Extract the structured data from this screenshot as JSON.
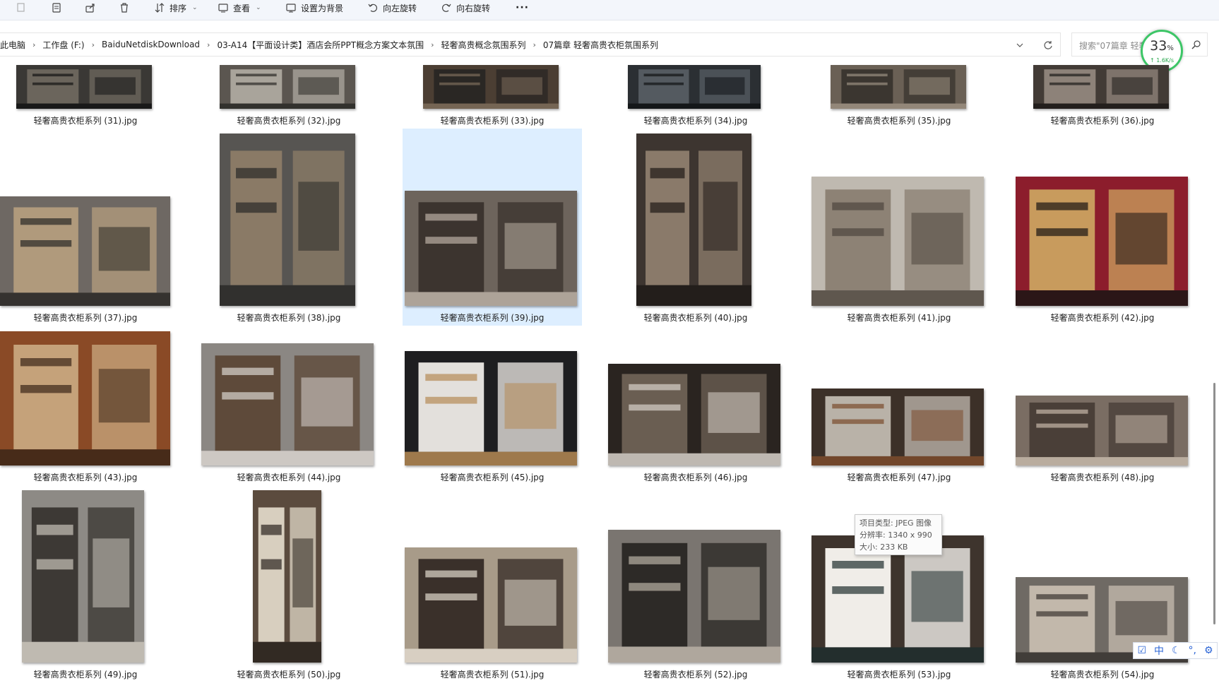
{
  "toolbar": {
    "sort_label": "排序",
    "view_label": "查看",
    "set_bg_label": "设置为背景",
    "rotate_left_label": "向左旋转",
    "rotate_right_label": "向右旋转",
    "more_label": "···"
  },
  "breadcrumb": [
    "此电脑",
    "工作盘 (F:)",
    "BaiduNetdiskDownload",
    "03-A14【平面设计类】酒店会所PPT概念方案文本氛围",
    "轻奢高贵概念氛围系列",
    "07篇章  轻奢高贵衣柜氛围系列"
  ],
  "breadcrumb_sep": "›",
  "search": {
    "placeholder": "搜索\"07篇章  轻奢..."
  },
  "net_widget": {
    "percent": "33",
    "unit": "%",
    "speed": "↑ 1.6K/s"
  },
  "files": [
    {
      "name": "轻奢高贵衣柜系列 (31).jpg"
    },
    {
      "name": "轻奢高贵衣柜系列 (32).jpg"
    },
    {
      "name": "轻奢高贵衣柜系列 (33).jpg"
    },
    {
      "name": "轻奢高贵衣柜系列 (34).jpg"
    },
    {
      "name": "轻奢高贵衣柜系列 (35).jpg"
    },
    {
      "name": "轻奢高贵衣柜系列 (36).jpg"
    },
    {
      "name": "轻奢高贵衣柜系列 (37).jpg"
    },
    {
      "name": "轻奢高贵衣柜系列 (38).jpg"
    },
    {
      "name": "轻奢高贵衣柜系列 (39).jpg",
      "selected": true
    },
    {
      "name": "轻奢高贵衣柜系列 (40).jpg"
    },
    {
      "name": "轻奢高贵衣柜系列 (41).jpg"
    },
    {
      "name": "轻奢高贵衣柜系列 (42).jpg"
    },
    {
      "name": "轻奢高贵衣柜系列 (43).jpg"
    },
    {
      "name": "轻奢高贵衣柜系列 (44).jpg"
    },
    {
      "name": "轻奢高贵衣柜系列 (45).jpg"
    },
    {
      "name": "轻奢高贵衣柜系列 (46).jpg"
    },
    {
      "name": "轻奢高贵衣柜系列 (47).jpg"
    },
    {
      "name": "轻奢高贵衣柜系列 (48).jpg"
    },
    {
      "name": "轻奢高贵衣柜系列 (49).jpg"
    },
    {
      "name": "轻奢高贵衣柜系列 (50).jpg"
    },
    {
      "name": "轻奢高贵衣柜系列 (51).jpg"
    },
    {
      "name": "轻奢高贵衣柜系列 (52).jpg"
    },
    {
      "name": "轻奢高贵衣柜系列 (53).jpg"
    },
    {
      "name": "轻奢高贵衣柜系列 (54).jpg"
    }
  ],
  "tooltip": {
    "type_line": "项目类型: JPEG 图像",
    "resolution_line": "分辨率: 1340 x 990",
    "size_line": "大小: 233 KB"
  },
  "ime": {
    "mode_label": "中"
  },
  "colors": {
    "selection": "#ddeeff",
    "toolbar_bg": "#f3f6fb",
    "net_ring": "#3dc667"
  }
}
